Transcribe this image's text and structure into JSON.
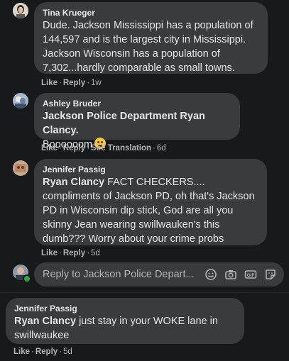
{
  "comments": [
    {
      "author": "Tina Krueger",
      "text": "Dude. Jackson Mississippi has a population of 144,597 and is the largest city in Mississippi. Jackson Wisconsin has a population of 7,302...hardly comparable as small towns.",
      "actions": [
        "Like",
        "Reply"
      ],
      "time": "1w"
    },
    {
      "author": "Ashley Bruder",
      "mention": "Jackson Police Department Ryan Clancy.",
      "text": "Boooooom",
      "actions": [
        "Like",
        "Reply",
        "See Translation"
      ],
      "time": "6d"
    },
    {
      "author": "Jennifer Passig",
      "mention": "Ryan Clancy",
      "text": " FACT CHECKERS.... compliments of Jackson PD, oh that's Jackson PD in Wisconsin dip stick, God are all you skinny Jean wearing swillwauken's this dumb??? Worry about your crime probs",
      "actions": [
        "Like",
        "Reply"
      ],
      "time": "5d"
    },
    {
      "author": "Jennifer Passig",
      "mention": "Ryan Clancy",
      "text": " just stay in your WOKE lane in swillwaukee",
      "actions": [
        "Like",
        "Reply"
      ],
      "time": "5d"
    }
  ],
  "reply_box": {
    "placeholder": "Reply to Jackson Police Depart...",
    "icons": [
      "emoji-icon",
      "camera-icon",
      "gif-icon",
      "sticker-icon"
    ]
  },
  "colors": {
    "background": "#18191a",
    "bubble": "#3a3b3c",
    "text": "#e4e6eb",
    "secondary": "#b0b3b8",
    "online": "#31a24c"
  }
}
